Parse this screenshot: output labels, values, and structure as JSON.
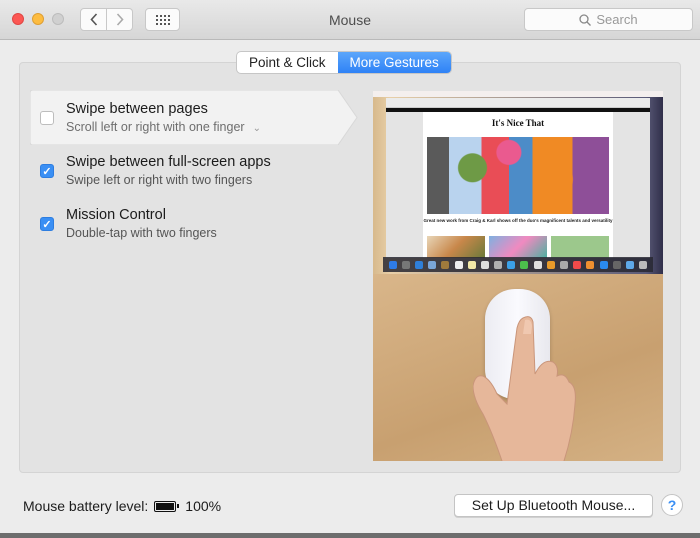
{
  "window": {
    "title": "Mouse",
    "search_placeholder": "Search"
  },
  "tabs": [
    {
      "label": "Point & Click",
      "active": false
    },
    {
      "label": "More Gestures",
      "active": true
    }
  ],
  "options": [
    {
      "title": "Swipe between pages",
      "subtitle": "Scroll left or right with one finger",
      "checked": false,
      "selected": true,
      "has_dropdown": true
    },
    {
      "title": "Swipe between full-screen apps",
      "subtitle": "Swipe left or right with two fingers",
      "checked": true,
      "selected": false
    },
    {
      "title": "Mission Control",
      "subtitle": "Double-tap with two fingers",
      "checked": true,
      "selected": false
    }
  ],
  "preview": {
    "site_title": "It's Nice That",
    "caption": "Great new work from Craig & Karl shows off the duo's magnificent talents and versatility"
  },
  "footer": {
    "battery_label": "Mouse battery level:",
    "battery_percent": "100%",
    "battery_level": 1.0,
    "setup_button": "Set Up Bluetooth Mouse...",
    "help_label": "?"
  },
  "colors": {
    "accent": "#3a8ff4",
    "close": "#fc5753",
    "minimize": "#fdbc40"
  }
}
